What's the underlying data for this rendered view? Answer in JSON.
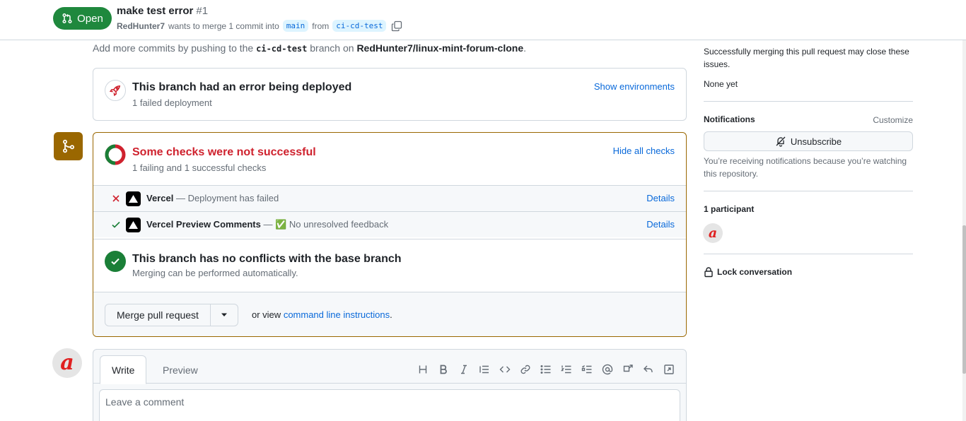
{
  "header": {
    "state": "Open",
    "title": "make test error",
    "number": "#1",
    "author": "RedHunter7",
    "merge_text": "wants to merge 1 commit into",
    "base_branch": "main",
    "from_text": "from",
    "head_branch": "ci-cd-test"
  },
  "push_hint": {
    "prefix": "Add more commits by pushing to the",
    "branch": "ci-cd-test",
    "middle": "branch on",
    "repo": "RedHunter7/linux-mint-forum-clone",
    "suffix": "."
  },
  "deployment": {
    "title": "This branch had an error being deployed",
    "subtitle": "1 failed deployment",
    "link": "Show environments"
  },
  "checks": {
    "title": "Some checks were not successful",
    "subtitle": "1 failing and 1 successful checks",
    "link": "Hide all checks",
    "items": [
      {
        "name": "Vercel",
        "description": "— Deployment has failed",
        "status": "failure",
        "link": "Details"
      },
      {
        "name": "Vercel Preview Comments",
        "description": "— ✅ No unresolved feedback",
        "status": "success",
        "link": "Details"
      }
    ]
  },
  "conflicts": {
    "title": "This branch has no conflicts with the base branch",
    "subtitle": "Merging can be performed automatically."
  },
  "merge": {
    "button": "Merge pull request",
    "or_view": "or view",
    "cli_link": "command line instructions",
    "period": "."
  },
  "editor": {
    "tabs": [
      "Write",
      "Preview"
    ],
    "placeholder": "Leave a comment"
  },
  "sidebar": {
    "issues_text": "Successfully merging this pull request may close these issues.",
    "issues_value": "None yet",
    "notifications_heading": "Notifications",
    "customize": "Customize",
    "unsubscribe": "Unsubscribe",
    "notify_reason": "You’re receiving notifications because you’re watching this repository.",
    "participants_heading": "1 participant",
    "lock": "Lock conversation"
  },
  "colors": {
    "open_green": "#1f883d",
    "failure_red": "#cf222e",
    "warning_brown": "#9a6700",
    "link_blue": "#0969da",
    "success_green": "#1a7f37"
  }
}
